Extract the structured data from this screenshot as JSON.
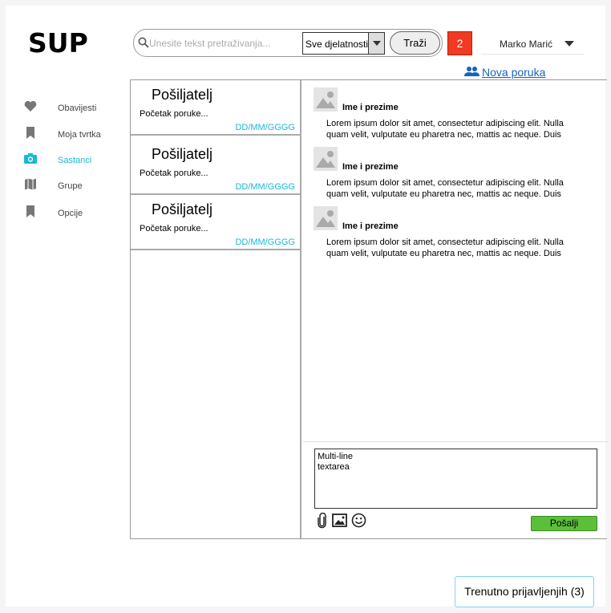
{
  "app": {
    "logo": "SUP"
  },
  "search": {
    "placeholder": "Unesite tekst pretraživanja...",
    "category": "Sve djelatnosti",
    "button_label": "Traži"
  },
  "notifications": {
    "count": "2"
  },
  "user": {
    "name": "Marko Marić"
  },
  "new_message": {
    "label": "Nova poruka"
  },
  "sidebar": {
    "items": [
      {
        "label": "Obavijesti",
        "icon": "heart-icon",
        "active": false
      },
      {
        "label": "Moja tvrtka",
        "icon": "bookmark-icon",
        "active": false
      },
      {
        "label": "Sastanci",
        "icon": "camera-icon",
        "active": true
      },
      {
        "label": "Grupe",
        "icon": "map-icon",
        "active": false
      },
      {
        "label": "Opcije",
        "icon": "bookmark-icon",
        "active": false
      }
    ]
  },
  "messages": [
    {
      "sender": "Pošiljatelj",
      "preview": "Početak poruke...",
      "date": "DD/MM/GGGG"
    },
    {
      "sender": "Pošiljatelj",
      "preview": "Početak poruke...",
      "date": "DD/MM/GGGG"
    },
    {
      "sender": "Pošiljatelj",
      "preview": "Početak poruke...",
      "date": "DD/MM/GGGG"
    }
  ],
  "thread": [
    {
      "name": "Ime i prezime",
      "text": "Lorem ipsum dolor sit amet, consectetur adipiscing elit. Nulla quam velit, vulputate eu pharetra nec, mattis ac neque. Duis"
    },
    {
      "name": "Ime i prezime",
      "text": "Lorem ipsum dolor sit amet, consectetur adipiscing elit. Nulla quam velit, vulputate eu pharetra nec, mattis ac neque. Duis"
    },
    {
      "name": "Ime i prezime",
      "text": "Lorem ipsum dolor sit amet, consectetur adipiscing elit. Nulla quam velit, vulputate eu pharetra nec, mattis ac neque. Duis"
    }
  ],
  "composer": {
    "value": "Multi-line\ntextarea",
    "tools": [
      "paperclip-icon",
      "image-icon",
      "emoji-icon"
    ],
    "send_label": "Pošalji"
  },
  "online_status": {
    "label": "Trenutno prijavljenjih (3)"
  },
  "colors": {
    "accent": "#18b8d8",
    "notify": "#f03a22",
    "send": "#5cbf3a",
    "link": "#1565c0"
  }
}
